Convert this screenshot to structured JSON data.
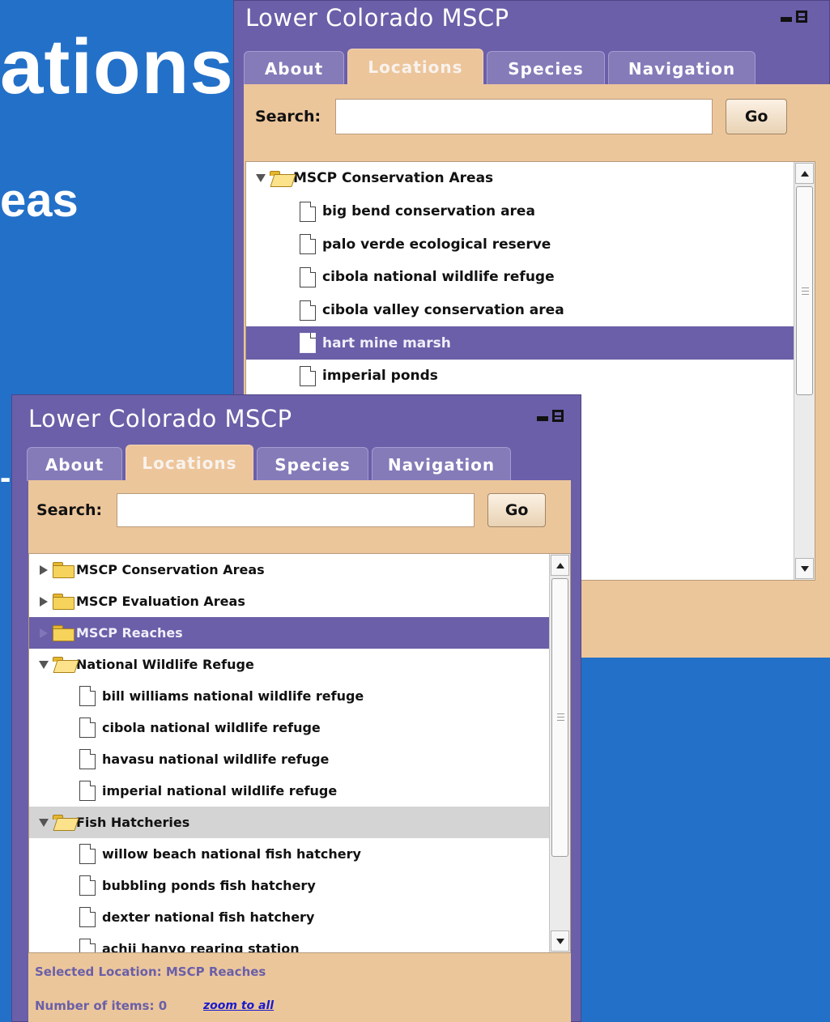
{
  "background": {
    "heading": "ations",
    "subheading": "eas",
    "fragment": "-"
  },
  "colors": {
    "page_bg": "#2370c8",
    "panel_bg": "#6a5fa8",
    "panel_body": "#ecc69b",
    "selection": "#6a5fa8"
  },
  "back_panel": {
    "title": "Lower Colorado MSCP",
    "tabs": [
      {
        "label": "About",
        "active": false
      },
      {
        "label": "Locations",
        "active": true
      },
      {
        "label": "Species",
        "active": false
      },
      {
        "label": "Navigation",
        "active": false
      }
    ],
    "search_label": "Search:",
    "search_value": "",
    "go_label": "Go",
    "tree": [
      {
        "label": "MSCP Conservation Areas",
        "type": "folder",
        "expanded": true
      },
      {
        "label": "big bend conservation area",
        "type": "item"
      },
      {
        "label": "palo verde ecological reserve",
        "type": "item"
      },
      {
        "label": "cibola national wildlife refuge",
        "type": "item"
      },
      {
        "label": "cibola valley conservation area",
        "type": "item"
      },
      {
        "label": "hart mine marsh",
        "type": "item",
        "selected": true
      },
      {
        "label": "imperial ponds",
        "type": "item"
      }
    ]
  },
  "front_panel": {
    "title": "Lower Colorado MSCP",
    "tabs": [
      {
        "label": "About",
        "active": false
      },
      {
        "label": "Locations",
        "active": true
      },
      {
        "label": "Species",
        "active": false
      },
      {
        "label": "Navigation",
        "active": false
      }
    ],
    "search_label": "Search:",
    "search_value": "",
    "go_label": "Go",
    "tree": [
      {
        "label": "MSCP Conservation Areas",
        "type": "folder",
        "expanded": false
      },
      {
        "label": "MSCP Evaluation Areas",
        "type": "folder",
        "expanded": false
      },
      {
        "label": "MSCP Reaches",
        "type": "folder",
        "expanded": false,
        "selected": true
      },
      {
        "label": "National Wildlife Refuge",
        "type": "folder",
        "expanded": true
      },
      {
        "label": "bill williams national wildlife refuge",
        "type": "item"
      },
      {
        "label": "cibola national wildlife refuge",
        "type": "item"
      },
      {
        "label": "havasu national wildlife refuge",
        "type": "item"
      },
      {
        "label": "imperial national wildlife refuge",
        "type": "item"
      },
      {
        "label": "Fish Hatcheries",
        "type": "folder",
        "expanded": true,
        "hovered": true
      },
      {
        "label": "willow beach national fish hatchery",
        "type": "item"
      },
      {
        "label": "bubbling ponds fish hatchery",
        "type": "item"
      },
      {
        "label": "dexter national fish hatchery",
        "type": "item"
      },
      {
        "label": "achii hanyo rearing station",
        "type": "item"
      }
    ],
    "selected_location": "Selected Location: MSCP Reaches",
    "item_count": "Number of items: 0",
    "zoom_link": "zoom to all"
  }
}
